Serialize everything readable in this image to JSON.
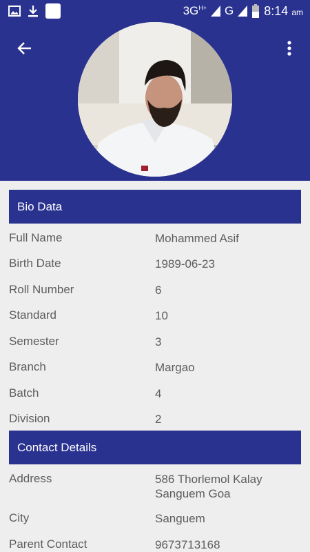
{
  "status_bar": {
    "network": "3G",
    "network_sup": "H+",
    "network2": "G",
    "time": "8:14",
    "ampm": "am"
  },
  "header": {
    "back_icon": "arrow-left-icon",
    "menu_icon": "more-vert-icon",
    "avatar": "profile-photo"
  },
  "bio": {
    "title": "Bio Data",
    "rows": [
      {
        "label": "Full Name",
        "value": "Mohammed Asif"
      },
      {
        "label": "Birth Date",
        "value": "1989-06-23"
      },
      {
        "label": "Roll Number",
        "value": "6"
      },
      {
        "label": "Standard",
        "value": "10"
      },
      {
        "label": "Semester",
        "value": "3"
      },
      {
        "label": "Branch",
        "value": "Margao"
      },
      {
        "label": "Batch",
        "value": "4"
      },
      {
        "label": "Division",
        "value": "2"
      }
    ]
  },
  "contact": {
    "title": "Contact Details",
    "rows": [
      {
        "label": "Address",
        "value": "586 Thorlemol Kalay Sanguem Goa"
      },
      {
        "label": "City",
        "value": "Sanguem"
      },
      {
        "label": "Parent Contact",
        "value": "9673713168"
      }
    ]
  },
  "colors": {
    "primary": "#2a3290",
    "background": "#eeeeee",
    "text": "#5d5d5d"
  }
}
